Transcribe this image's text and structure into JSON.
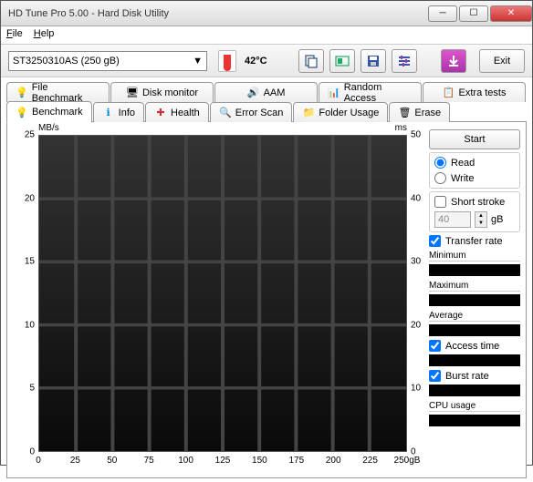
{
  "window": {
    "title": "HD Tune Pro 5.00 - Hard Disk Utility"
  },
  "menu": {
    "file": "File",
    "help": "Help"
  },
  "toolbar": {
    "drive": "ST3250310AS (250 gB)",
    "temp": "42°C",
    "exit": "Exit"
  },
  "tabs_upper": [
    "File Benchmark",
    "Disk monitor",
    "AAM",
    "Random Access",
    "Extra tests"
  ],
  "tabs_lower": [
    "Benchmark",
    "Info",
    "Health",
    "Error Scan",
    "Folder Usage",
    "Erase"
  ],
  "side": {
    "start": "Start",
    "read": "Read",
    "write": "Write",
    "short_stroke": "Short stroke",
    "stroke_val": "40",
    "stroke_unit": "gB",
    "transfer": "Transfer rate",
    "min": "Minimum",
    "max": "Maximum",
    "avg": "Average",
    "access": "Access time",
    "burst": "Burst rate",
    "cpu": "CPU usage"
  },
  "chart_data": {
    "type": "line",
    "title": "",
    "xlabel": "gB",
    "ylabel": "MB/s",
    "ylabel2": "ms",
    "x_ticks": [
      0,
      25,
      50,
      75,
      100,
      125,
      150,
      175,
      200,
      225,
      250
    ],
    "y_left": [
      0,
      5,
      10,
      15,
      20,
      25
    ],
    "y_right": [
      0,
      10,
      20,
      30,
      40,
      50
    ],
    "xlim": [
      0,
      250
    ],
    "ylim": [
      0,
      25
    ],
    "ylim2": [
      0,
      50
    ],
    "series": [],
    "x_unit_suffix": "gB"
  }
}
